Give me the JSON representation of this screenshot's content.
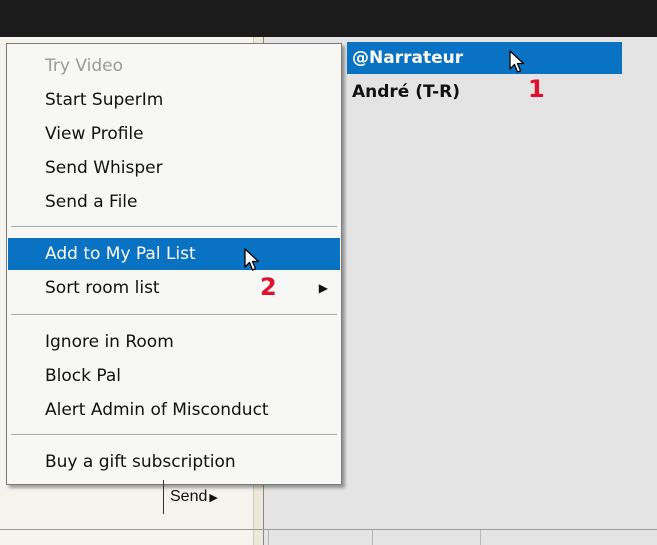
{
  "context_menu": {
    "items": [
      {
        "label": "Try Video",
        "disabled": true
      },
      {
        "label": "Start SuperIm"
      },
      {
        "label": "View Profile"
      },
      {
        "label": "Send Whisper"
      },
      {
        "label": "Send a File"
      },
      {
        "label": "Add to My Pal List",
        "highlighted": true
      },
      {
        "label": "Sort room list",
        "has_submenu": true
      },
      {
        "label": "Ignore in Room"
      },
      {
        "label": "Block Pal"
      },
      {
        "label": "Alert Admin of Misconduct"
      },
      {
        "label": "Buy a gift subscription"
      }
    ],
    "submenu_arrow_icon": "triangle-right-icon"
  },
  "room_list": {
    "users": [
      {
        "name": "@Narrateur",
        "selected": true
      },
      {
        "name": "André (T-R)"
      }
    ]
  },
  "callouts": {
    "one": "1",
    "two": "2"
  },
  "send_button": {
    "label": "Send",
    "icon": "triangle-right-icon"
  },
  "colors": {
    "selection": "#0a72c2",
    "callout": "#e0102f",
    "topbar": "#1b1b1b"
  }
}
